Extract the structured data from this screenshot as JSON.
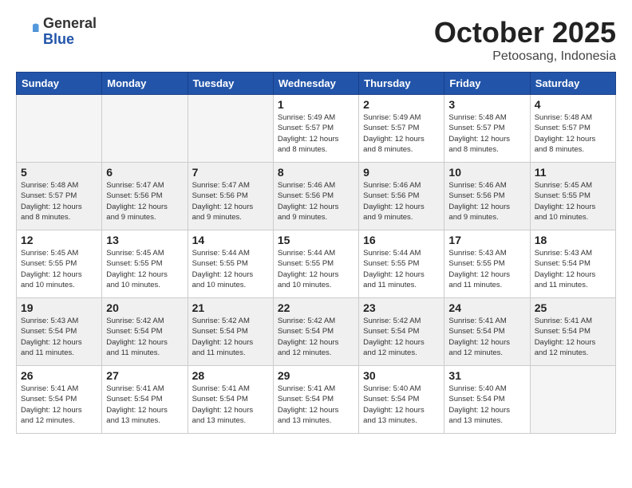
{
  "logo": {
    "general": "General",
    "blue": "Blue"
  },
  "title": "October 2025",
  "subtitle": "Petoosang, Indonesia",
  "days_of_week": [
    "Sunday",
    "Monday",
    "Tuesday",
    "Wednesday",
    "Thursday",
    "Friday",
    "Saturday"
  ],
  "weeks": [
    {
      "shaded": false,
      "days": [
        {
          "num": "",
          "info": ""
        },
        {
          "num": "",
          "info": ""
        },
        {
          "num": "",
          "info": ""
        },
        {
          "num": "1",
          "info": "Sunrise: 5:49 AM\nSunset: 5:57 PM\nDaylight: 12 hours\nand 8 minutes."
        },
        {
          "num": "2",
          "info": "Sunrise: 5:49 AM\nSunset: 5:57 PM\nDaylight: 12 hours\nand 8 minutes."
        },
        {
          "num": "3",
          "info": "Sunrise: 5:48 AM\nSunset: 5:57 PM\nDaylight: 12 hours\nand 8 minutes."
        },
        {
          "num": "4",
          "info": "Sunrise: 5:48 AM\nSunset: 5:57 PM\nDaylight: 12 hours\nand 8 minutes."
        }
      ]
    },
    {
      "shaded": true,
      "days": [
        {
          "num": "5",
          "info": "Sunrise: 5:48 AM\nSunset: 5:57 PM\nDaylight: 12 hours\nand 8 minutes."
        },
        {
          "num": "6",
          "info": "Sunrise: 5:47 AM\nSunset: 5:56 PM\nDaylight: 12 hours\nand 9 minutes."
        },
        {
          "num": "7",
          "info": "Sunrise: 5:47 AM\nSunset: 5:56 PM\nDaylight: 12 hours\nand 9 minutes."
        },
        {
          "num": "8",
          "info": "Sunrise: 5:46 AM\nSunset: 5:56 PM\nDaylight: 12 hours\nand 9 minutes."
        },
        {
          "num": "9",
          "info": "Sunrise: 5:46 AM\nSunset: 5:56 PM\nDaylight: 12 hours\nand 9 minutes."
        },
        {
          "num": "10",
          "info": "Sunrise: 5:46 AM\nSunset: 5:56 PM\nDaylight: 12 hours\nand 9 minutes."
        },
        {
          "num": "11",
          "info": "Sunrise: 5:45 AM\nSunset: 5:55 PM\nDaylight: 12 hours\nand 10 minutes."
        }
      ]
    },
    {
      "shaded": false,
      "days": [
        {
          "num": "12",
          "info": "Sunrise: 5:45 AM\nSunset: 5:55 PM\nDaylight: 12 hours\nand 10 minutes."
        },
        {
          "num": "13",
          "info": "Sunrise: 5:45 AM\nSunset: 5:55 PM\nDaylight: 12 hours\nand 10 minutes."
        },
        {
          "num": "14",
          "info": "Sunrise: 5:44 AM\nSunset: 5:55 PM\nDaylight: 12 hours\nand 10 minutes."
        },
        {
          "num": "15",
          "info": "Sunrise: 5:44 AM\nSunset: 5:55 PM\nDaylight: 12 hours\nand 10 minutes."
        },
        {
          "num": "16",
          "info": "Sunrise: 5:44 AM\nSunset: 5:55 PM\nDaylight: 12 hours\nand 11 minutes."
        },
        {
          "num": "17",
          "info": "Sunrise: 5:43 AM\nSunset: 5:55 PM\nDaylight: 12 hours\nand 11 minutes."
        },
        {
          "num": "18",
          "info": "Sunrise: 5:43 AM\nSunset: 5:54 PM\nDaylight: 12 hours\nand 11 minutes."
        }
      ]
    },
    {
      "shaded": true,
      "days": [
        {
          "num": "19",
          "info": "Sunrise: 5:43 AM\nSunset: 5:54 PM\nDaylight: 12 hours\nand 11 minutes."
        },
        {
          "num": "20",
          "info": "Sunrise: 5:42 AM\nSunset: 5:54 PM\nDaylight: 12 hours\nand 11 minutes."
        },
        {
          "num": "21",
          "info": "Sunrise: 5:42 AM\nSunset: 5:54 PM\nDaylight: 12 hours\nand 11 minutes."
        },
        {
          "num": "22",
          "info": "Sunrise: 5:42 AM\nSunset: 5:54 PM\nDaylight: 12 hours\nand 12 minutes."
        },
        {
          "num": "23",
          "info": "Sunrise: 5:42 AM\nSunset: 5:54 PM\nDaylight: 12 hours\nand 12 minutes."
        },
        {
          "num": "24",
          "info": "Sunrise: 5:41 AM\nSunset: 5:54 PM\nDaylight: 12 hours\nand 12 minutes."
        },
        {
          "num": "25",
          "info": "Sunrise: 5:41 AM\nSunset: 5:54 PM\nDaylight: 12 hours\nand 12 minutes."
        }
      ]
    },
    {
      "shaded": false,
      "days": [
        {
          "num": "26",
          "info": "Sunrise: 5:41 AM\nSunset: 5:54 PM\nDaylight: 12 hours\nand 12 minutes."
        },
        {
          "num": "27",
          "info": "Sunrise: 5:41 AM\nSunset: 5:54 PM\nDaylight: 12 hours\nand 13 minutes."
        },
        {
          "num": "28",
          "info": "Sunrise: 5:41 AM\nSunset: 5:54 PM\nDaylight: 12 hours\nand 13 minutes."
        },
        {
          "num": "29",
          "info": "Sunrise: 5:41 AM\nSunset: 5:54 PM\nDaylight: 12 hours\nand 13 minutes."
        },
        {
          "num": "30",
          "info": "Sunrise: 5:40 AM\nSunset: 5:54 PM\nDaylight: 12 hours\nand 13 minutes."
        },
        {
          "num": "31",
          "info": "Sunrise: 5:40 AM\nSunset: 5:54 PM\nDaylight: 12 hours\nand 13 minutes."
        },
        {
          "num": "",
          "info": ""
        }
      ]
    }
  ]
}
